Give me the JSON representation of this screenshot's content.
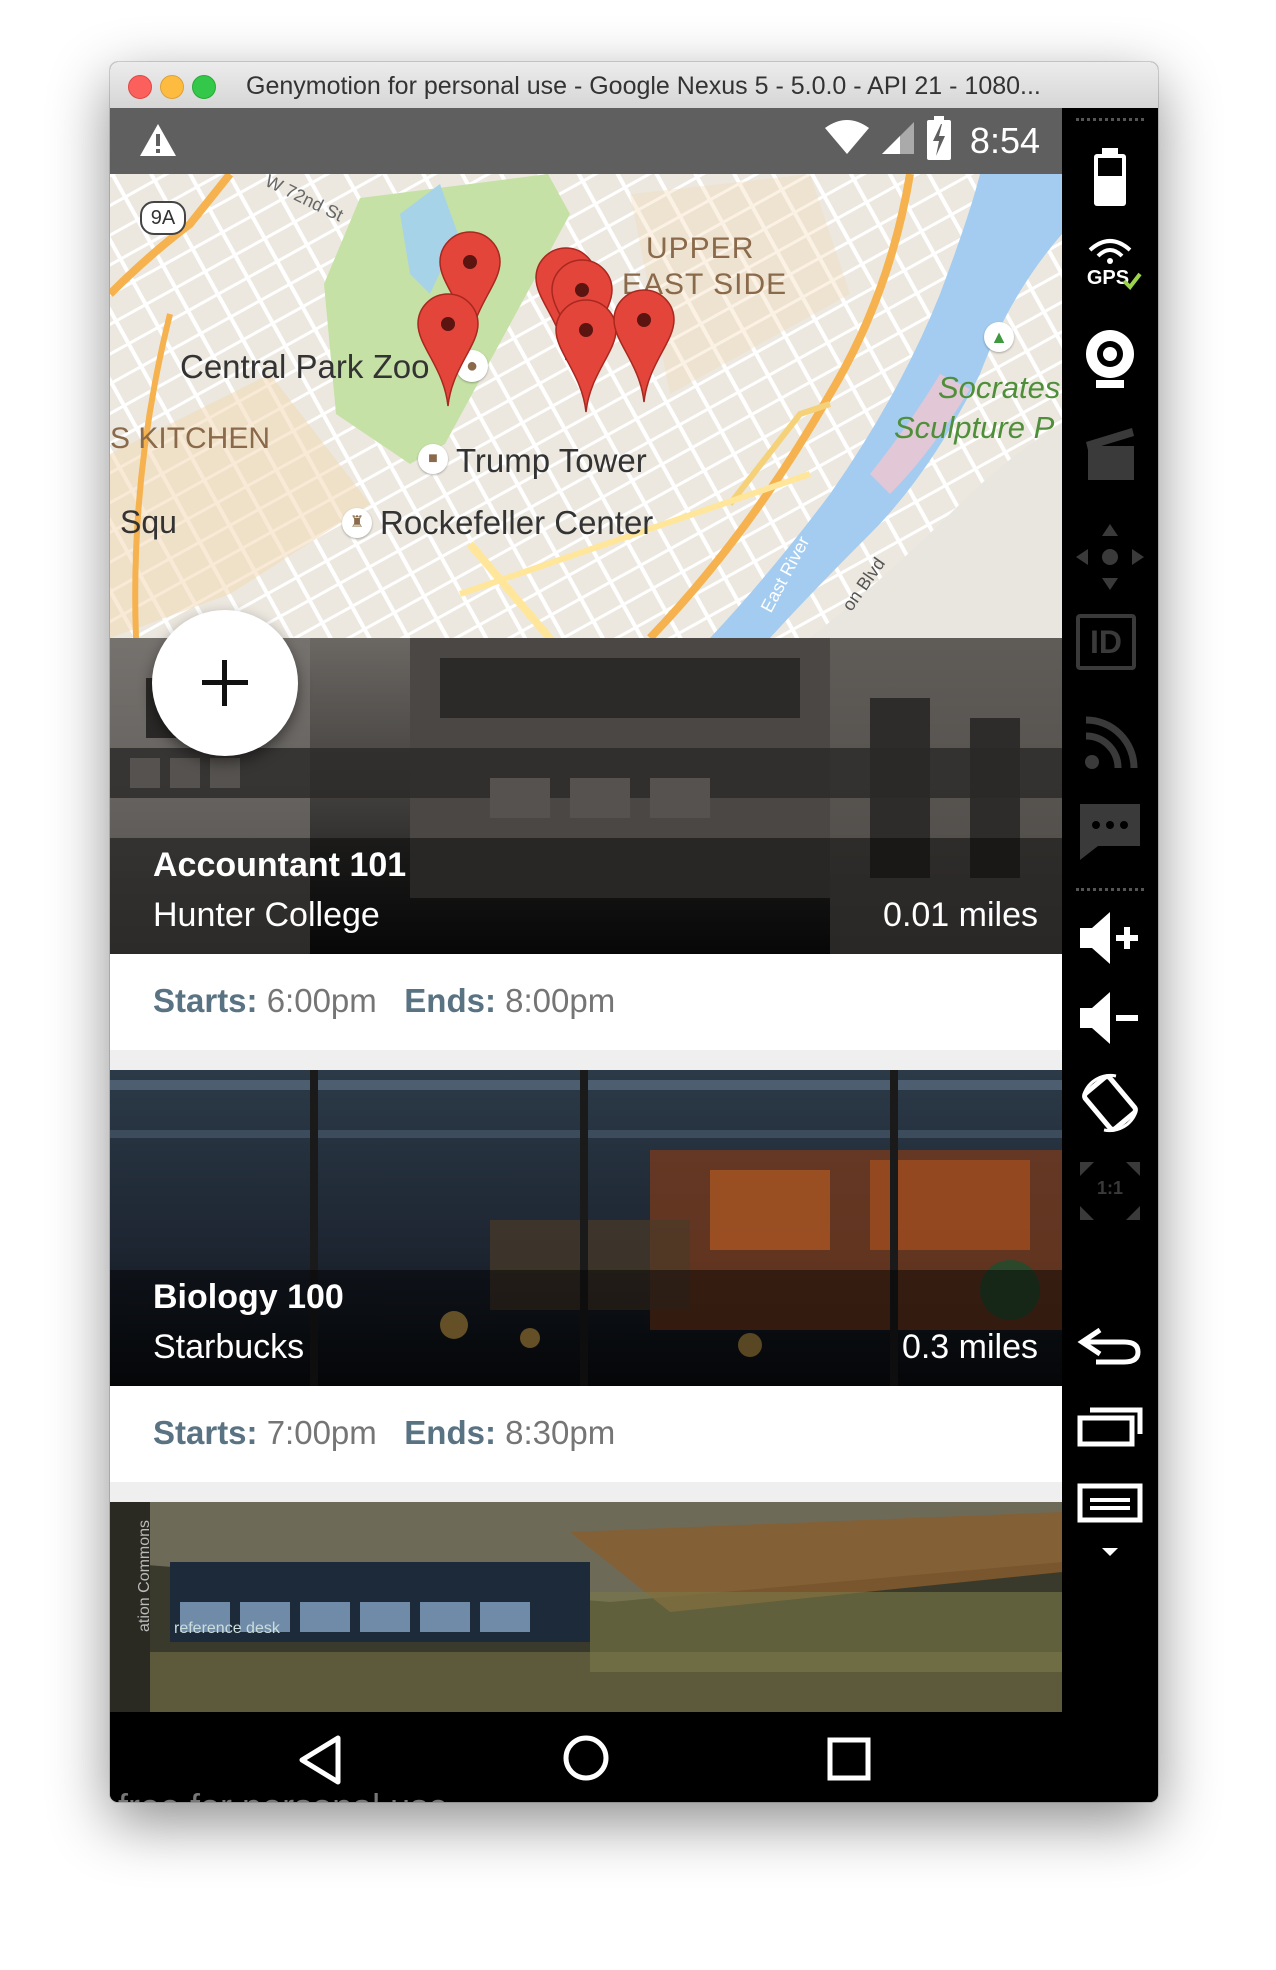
{
  "window": {
    "title": "Genymotion for personal use - Google Nexus 5 - 5.0.0 - API 21 - 1080..."
  },
  "status_bar": {
    "time": "8:54",
    "icons": [
      "warning-icon",
      "wifi-icon",
      "signal-icon",
      "battery-charging-icon"
    ]
  },
  "map": {
    "labels": {
      "highway": "9A",
      "street": "W 72nd St",
      "upper_east_side_1": "UPPER",
      "upper_east_side_2": "EAST SIDE",
      "zoo": "Central Park Zoo",
      "kitchen": "S KITCHEN",
      "trump": "Trump Tower",
      "square": "Squ",
      "rockefeller": "Rockefeller Center",
      "socrates_1": "Socrates",
      "socrates_2": "Sculpture P",
      "east_river": "East River",
      "blvd": "on Blvd"
    },
    "marker_count": 6
  },
  "fab": {
    "icon": "add-icon"
  },
  "events": [
    {
      "title": "Accountant 101",
      "location": "Hunter College",
      "distance": "0.01 miles",
      "starts_label": "Starts:",
      "starts": "6:00pm",
      "ends_label": "Ends:",
      "ends": "8:00pm"
    },
    {
      "title": "Biology 100",
      "location": "Starbucks",
      "distance": "0.3 miles",
      "starts_label": "Starts:",
      "starts": "7:00pm",
      "ends_label": "Ends:",
      "ends": "8:30pm"
    }
  ],
  "third_card": {
    "sign_text": "ation Commons",
    "desk_text": "reference desk"
  },
  "nav_bar": {
    "buttons": [
      "back-icon",
      "home-icon",
      "recents-icon"
    ]
  },
  "watermark": "free for personal use",
  "sidebar": {
    "gps_label": "GPS",
    "id_label": "ID",
    "scale_label": "1:1",
    "items": [
      "battery-icon",
      "gps-icon",
      "webcam-icon",
      "capture-icon",
      "dpad-icon",
      "id-icon",
      "cast-icon",
      "sms-icon",
      "volume-up-icon",
      "volume-down-icon",
      "rotate-icon",
      "scale-icon",
      "back-icon",
      "recents-icon",
      "menu-icon"
    ]
  }
}
